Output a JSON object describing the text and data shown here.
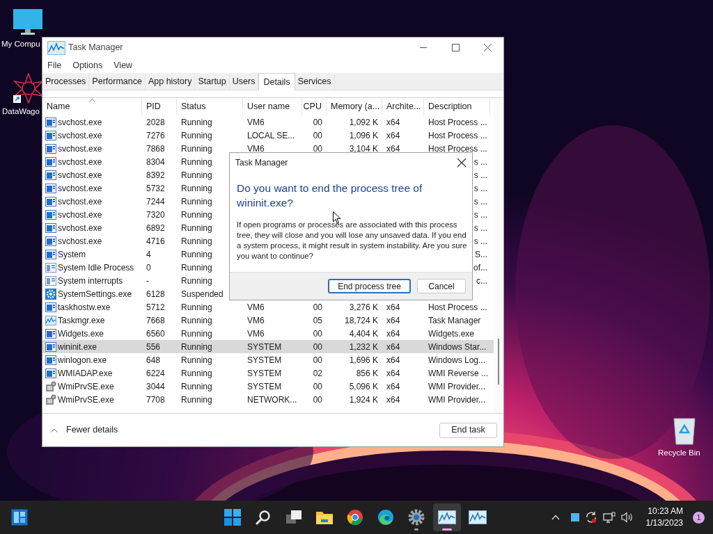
{
  "desktop_icons": [
    {
      "kind": "monitor",
      "label": "My Compu"
    },
    {
      "kind": "star",
      "label": "DataWago"
    },
    {
      "kind": "recycle",
      "label": "Recycle Bin"
    }
  ],
  "window": {
    "title": "Task Manager",
    "menu": [
      "File",
      "Options",
      "View"
    ],
    "tabs": [
      {
        "label": "Processes",
        "selected": false
      },
      {
        "label": "Performance",
        "selected": false
      },
      {
        "label": "App history",
        "selected": false
      },
      {
        "label": "Startup",
        "selected": false
      },
      {
        "label": "Users",
        "selected": false
      },
      {
        "label": "Details",
        "selected": true
      },
      {
        "label": "Services",
        "selected": false
      }
    ],
    "table": {
      "columns": [
        "Name",
        "PID",
        "Status",
        "User name",
        "CPU",
        "Memory (a...",
        "Archite...",
        "Description"
      ],
      "rows": [
        {
          "kind": "service",
          "selected": false,
          "name": "svchost.exe",
          "pid": "2028",
          "status": "Running",
          "user": "VM6",
          "cpu": "00",
          "memory": "1,092 K",
          "arch": "x64",
          "description": "Host Process ..."
        },
        {
          "kind": "service",
          "selected": false,
          "name": "svchost.exe",
          "pid": "7276",
          "status": "Running",
          "user": "LOCAL SE...",
          "cpu": "00",
          "memory": "1,096 K",
          "arch": "x64",
          "description": "Host Process ..."
        },
        {
          "kind": "service",
          "selected": false,
          "name": "svchost.exe",
          "pid": "7868",
          "status": "Running",
          "user": "VM6",
          "cpu": "00",
          "memory": "3,104 K",
          "arch": "x64",
          "description": "Host Process ..."
        },
        {
          "kind": "service",
          "selected": false,
          "name": "svchost.exe",
          "pid": "8304",
          "status": "Running",
          "description": "s ..."
        },
        {
          "kind": "service",
          "selected": false,
          "name": "svchost.exe",
          "pid": "8392",
          "status": "Running",
          "description": "s ..."
        },
        {
          "kind": "service",
          "selected": false,
          "name": "svchost.exe",
          "pid": "5732",
          "status": "Running",
          "description": "s ..."
        },
        {
          "kind": "service",
          "selected": false,
          "name": "svchost.exe",
          "pid": "7244",
          "status": "Running",
          "description": "s ..."
        },
        {
          "kind": "service",
          "selected": false,
          "name": "svchost.exe",
          "pid": "7320",
          "status": "Running",
          "description": "s ..."
        },
        {
          "kind": "service",
          "selected": false,
          "name": "svchost.exe",
          "pid": "6892",
          "status": "Running",
          "description": "s ..."
        },
        {
          "kind": "service",
          "selected": false,
          "name": "svchost.exe",
          "pid": "4716",
          "status": "Running",
          "description": "s ..."
        },
        {
          "kind": "service",
          "selected": false,
          "name": "System",
          "pid": "4",
          "status": "Running",
          "description": "S..."
        },
        {
          "kind": "system",
          "selected": false,
          "name": "System Idle Process",
          "pid": "0",
          "status": "Running",
          "description": "of..."
        },
        {
          "kind": "system",
          "selected": false,
          "name": "System interrupts",
          "pid": "-",
          "status": "Running",
          "description": "c..."
        },
        {
          "kind": "gear",
          "selected": false,
          "name": "SystemSettings.exe",
          "pid": "6128",
          "status": "Suspended"
        },
        {
          "kind": "service",
          "selected": false,
          "name": "taskhostw.exe",
          "pid": "5712",
          "status": "Running",
          "user": "VM6",
          "cpu": "00",
          "memory": "3,276 K",
          "arch": "x64",
          "description": "Host Process ..."
        },
        {
          "kind": "chart",
          "selected": false,
          "name": "Taskmgr.exe",
          "pid": "7668",
          "status": "Running",
          "user": "VM6",
          "cpu": "05",
          "memory": "18,724 K",
          "arch": "x64",
          "description": "Task Manager"
        },
        {
          "kind": "service",
          "selected": false,
          "name": "Widgets.exe",
          "pid": "6560",
          "status": "Running",
          "user": "VM6",
          "cpu": "00",
          "memory": "4,404 K",
          "arch": "x64",
          "description": "Widgets.exe"
        },
        {
          "kind": "service",
          "selected": true,
          "name": "wininit.exe",
          "pid": "556",
          "status": "Running",
          "user": "SYSTEM",
          "cpu": "00",
          "memory": "1,232 K",
          "arch": "x64",
          "description": "Windows Star..."
        },
        {
          "kind": "service",
          "selected": false,
          "name": "winlogon.exe",
          "pid": "648",
          "status": "Running",
          "user": "SYSTEM",
          "cpu": "00",
          "memory": "1,696 K",
          "arch": "x64",
          "description": "Windows Log..."
        },
        {
          "kind": "service",
          "selected": false,
          "name": "WMIADAP.exe",
          "pid": "6224",
          "status": "Running",
          "user": "SYSTEM",
          "cpu": "02",
          "memory": "856 K",
          "arch": "x64",
          "description": "WMI Reverse ..."
        },
        {
          "kind": "wmi",
          "selected": false,
          "name": "WmiPrvSE.exe",
          "pid": "3044",
          "status": "Running",
          "user": "SYSTEM",
          "cpu": "00",
          "memory": "5,096 K",
          "arch": "x64",
          "description": "WMI Provider..."
        },
        {
          "kind": "wmi",
          "selected": false,
          "name": "WmiPrvSE.exe",
          "pid": "7708",
          "status": "Running",
          "user": "NETWORK...",
          "cpu": "00",
          "memory": "1,924 K",
          "arch": "x64",
          "description": "WMI Provider..."
        }
      ]
    },
    "footer": {
      "fewer_details": "Fewer details",
      "end_task": "End task"
    }
  },
  "dialog": {
    "title": "Task Manager",
    "heading": "Do you want to end the process tree of wininit.exe?",
    "body": "If open programs or processes are associated with this process tree, they will close and you will lose any unsaved data. If you end a system process, it might result in system instability. Are you sure you want to continue?",
    "buttons": [
      {
        "label": "End process tree",
        "default": true
      },
      {
        "label": "Cancel",
        "default": false
      }
    ]
  },
  "taskbar": {
    "apps": [
      {
        "kind": "start",
        "running": false,
        "active": false
      },
      {
        "kind": "search",
        "running": false,
        "active": false
      },
      {
        "kind": "taskview",
        "running": false,
        "active": false
      },
      {
        "kind": "folder",
        "running": false,
        "active": false
      },
      {
        "kind": "chrome",
        "running": false,
        "active": false
      },
      {
        "kind": "edge",
        "running": false,
        "active": false
      },
      {
        "kind": "gear",
        "running": true,
        "active": false
      },
      {
        "kind": "chart",
        "running": true,
        "active": true
      },
      {
        "kind": "chart",
        "running": false,
        "active": false
      }
    ],
    "time": "10:23 AM",
    "date": "1/13/2023",
    "badge": "1"
  }
}
